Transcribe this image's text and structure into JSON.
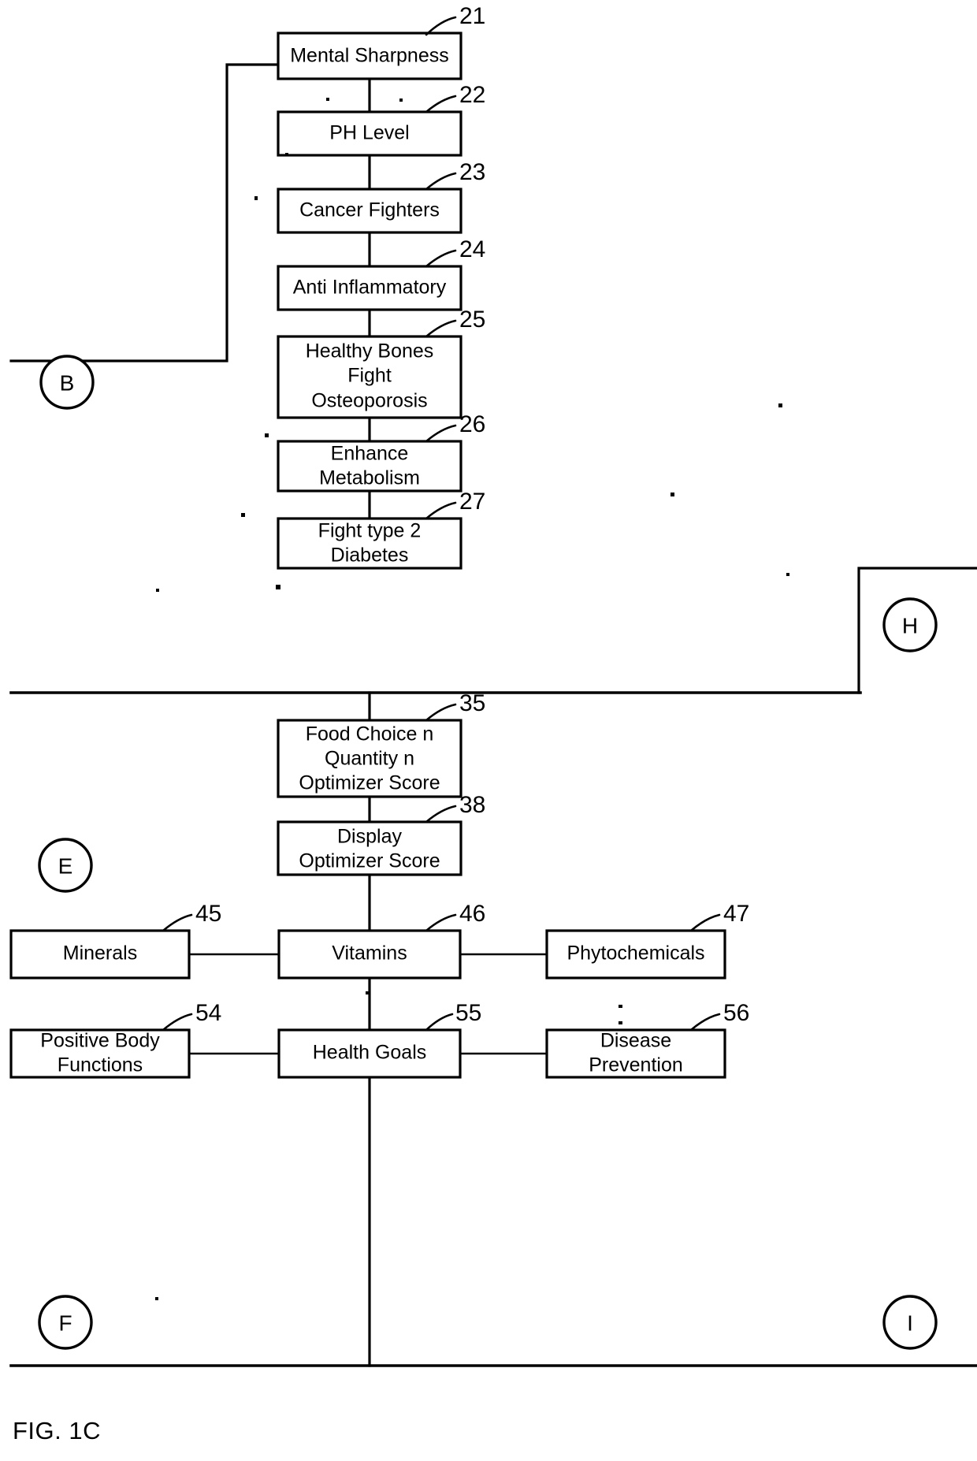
{
  "figure": {
    "caption": "FIG. 1C",
    "sheet_type": "patent-flow-diagram"
  },
  "boxes": [
    {
      "id": "b21",
      "ref": "21",
      "lines": [
        "Mental Sharpness"
      ]
    },
    {
      "id": "b22",
      "ref": "22",
      "lines": [
        "PH Level"
      ]
    },
    {
      "id": "b23",
      "ref": "23",
      "lines": [
        "Cancer Fighters"
      ]
    },
    {
      "id": "b24",
      "ref": "24",
      "lines": [
        "Anti Inflammatory"
      ]
    },
    {
      "id": "b25",
      "ref": "25",
      "lines": [
        "Healthy Bones",
        "Fight",
        "Osteoporosis"
      ]
    },
    {
      "id": "b26",
      "ref": "26",
      "lines": [
        "Enhance",
        "Metabolism"
      ]
    },
    {
      "id": "b27",
      "ref": "27",
      "lines": [
        "Fight type 2",
        "Diabetes"
      ]
    },
    {
      "id": "b35",
      "ref": "35",
      "lines": [
        "Food Choice n",
        "Quantity n",
        "Optimizer Score"
      ]
    },
    {
      "id": "b38",
      "ref": "38",
      "lines": [
        "Display",
        "Optimizer Score"
      ]
    },
    {
      "id": "b45",
      "ref": "45",
      "lines": [
        "Minerals"
      ]
    },
    {
      "id": "b46",
      "ref": "46",
      "lines": [
        "Vitamins"
      ]
    },
    {
      "id": "b47",
      "ref": "47",
      "lines": [
        "Phytochemicals"
      ]
    },
    {
      "id": "b54",
      "ref": "54",
      "lines": [
        "Positive Body",
        "Functions"
      ]
    },
    {
      "id": "b55",
      "ref": "55",
      "lines": [
        "Health Goals"
      ]
    },
    {
      "id": "b56",
      "ref": "56",
      "lines": [
        "Disease",
        "Prevention"
      ]
    }
  ],
  "connector_nodes": [
    {
      "id": "nB",
      "label": "B"
    },
    {
      "id": "nH",
      "label": "H"
    },
    {
      "id": "nE",
      "label": "E"
    },
    {
      "id": "nF",
      "label": "F"
    },
    {
      "id": "nI",
      "label": "I"
    }
  ],
  "box_text": {
    "b21_l1": "Mental Sharpness",
    "b22_l1": "PH Level",
    "b23_l1": "Cancer Fighters",
    "b24_l1": "Anti Inflammatory",
    "b25_l1": "Healthy Bones",
    "b25_l2": "Fight",
    "b25_l3": "Osteoporosis",
    "b26_l1": "Enhance",
    "b26_l2": "Metabolism",
    "b27_l1": "Fight type 2",
    "b27_l2": "Diabetes",
    "b35_l1": "Food Choice n",
    "b35_l2": "Quantity n",
    "b35_l3": "Optimizer Score",
    "b38_l1": "Display",
    "b38_l2": "Optimizer Score",
    "b45_l1": "Minerals",
    "b46_l1": "Vitamins",
    "b47_l1": "Phytochemicals",
    "b54_l1": "Positive Body",
    "b54_l2": "Functions",
    "b55_l1": "Health Goals",
    "b56_l1": "Disease",
    "b56_l2": "Prevention"
  },
  "ref_numbers": {
    "r21": "21",
    "r22": "22",
    "r23": "23",
    "r24": "24",
    "r25": "25",
    "r26": "26",
    "r27": "27",
    "r35": "35",
    "r38": "38",
    "r45": "45",
    "r46": "46",
    "r47": "47",
    "r54": "54",
    "r55": "55",
    "r56": "56"
  },
  "node_letters": {
    "nB": "B",
    "nH": "H",
    "nE": "E",
    "nF": "F",
    "nI": "I"
  },
  "colors": {
    "ink": "#000000",
    "paper": "#ffffff"
  }
}
